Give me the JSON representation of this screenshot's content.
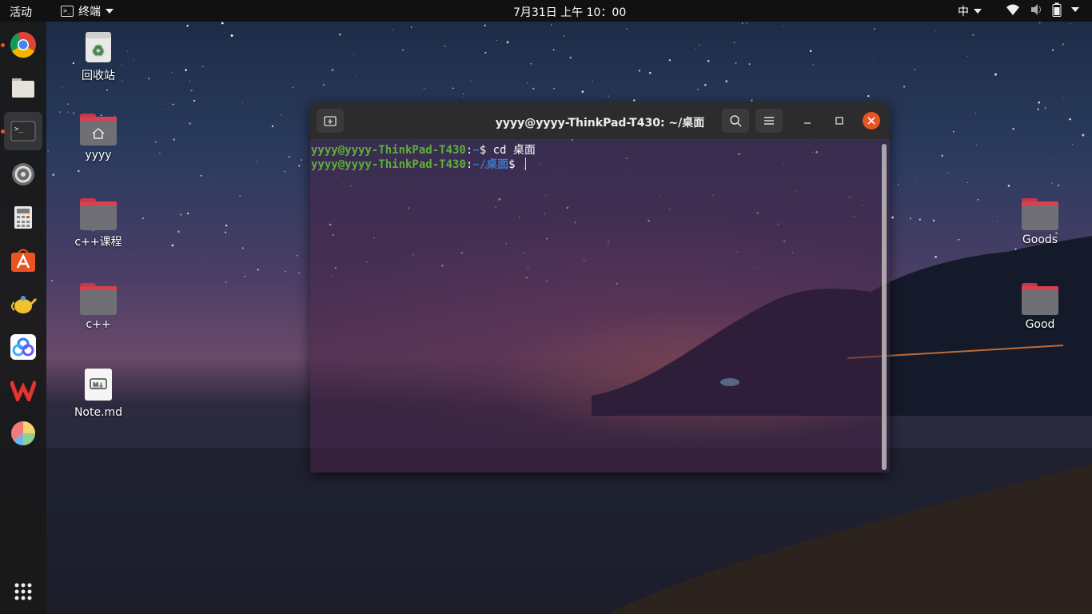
{
  "topbar": {
    "activities": "活动",
    "app_name": "终端",
    "clock": "7月31日 上午 10：00",
    "input_method": "中"
  },
  "dock": {
    "items": [
      {
        "name": "chrome",
        "icon": "chrome-icon",
        "running": true
      },
      {
        "name": "files",
        "icon": "files-icon",
        "running": false
      },
      {
        "name": "terminal",
        "icon": "terminal-icon",
        "running": true,
        "active": true
      },
      {
        "name": "settings",
        "icon": "gear-icon",
        "running": false
      },
      {
        "name": "calculator",
        "icon": "calculator-icon",
        "running": false
      },
      {
        "name": "software",
        "icon": "software-center-icon",
        "running": false
      },
      {
        "name": "teapot",
        "icon": "teapot-icon",
        "running": false
      },
      {
        "name": "baidu-netdisk",
        "icon": "cloud-icon",
        "running": false
      },
      {
        "name": "wps",
        "icon": "wps-icon",
        "running": false
      },
      {
        "name": "pie",
        "icon": "pie-icon",
        "running": false
      },
      {
        "name": "show-apps",
        "icon": "app-grid-icon",
        "running": false
      }
    ]
  },
  "desktop": {
    "icons": [
      {
        "label": "回收站",
        "icon": "trash-icon"
      },
      {
        "label": "yyyy",
        "icon": "home-folder-icon"
      },
      {
        "label": "c++课程",
        "icon": "folder-icon"
      },
      {
        "label": "c++",
        "icon": "folder-icon"
      },
      {
        "label": "Note.md",
        "icon": "markdown-file-icon"
      },
      {
        "label": "Goods",
        "icon": "folder-icon"
      },
      {
        "label": "Good",
        "icon": "folder-icon"
      }
    ]
  },
  "terminal": {
    "title": "yyyy@yyyy-ThinkPad-T430: ~/桌面",
    "lines": [
      {
        "user": "yyyy@yyyy-ThinkPad-T430",
        "sep": ":",
        "path": "~",
        "prompt": "$ ",
        "cmd": "cd 桌面"
      },
      {
        "user": "yyyy@yyyy-ThinkPad-T430",
        "sep": ":",
        "path": "~/桌面",
        "prompt": "$ ",
        "cmd": ""
      }
    ]
  },
  "colors": {
    "prompt_user": "#5faf3a",
    "prompt_path": "#3b78c7",
    "close_button": "#e95420",
    "folder_tab": "#d9414f"
  }
}
